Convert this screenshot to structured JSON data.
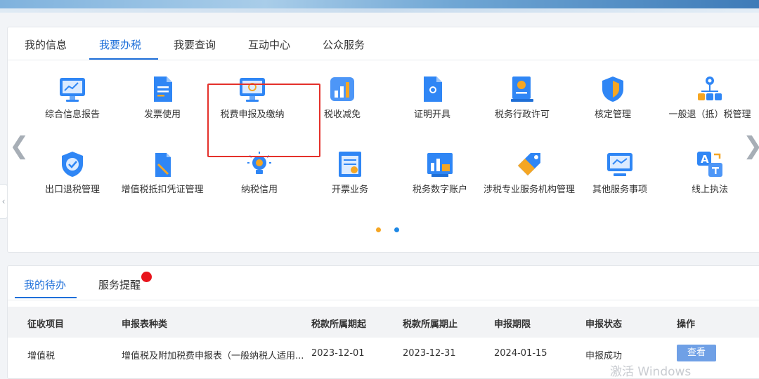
{
  "tabs": [
    "我的信息",
    "我要办税",
    "我要查询",
    "互动中心",
    "公众服务"
  ],
  "active_tab": "我要办税",
  "services": [
    {
      "label": "综合信息报告",
      "icon": "report-monitor-icon"
    },
    {
      "label": "发票使用",
      "icon": "invoice-document-icon"
    },
    {
      "label": "税费申报及缴纳",
      "icon": "tax-declare-monitor-icon"
    },
    {
      "label": "税收减免",
      "icon": "tax-reduction-chart-icon"
    },
    {
      "label": "证明开具",
      "icon": "certificate-document-icon"
    },
    {
      "label": "税务行政许可",
      "icon": "license-badge-icon"
    },
    {
      "label": "核定管理",
      "icon": "shield-icon"
    },
    {
      "label": "一般退（抵）税管理",
      "icon": "org-tree-icon"
    },
    {
      "label": "出口退税管理",
      "icon": "shield-check-icon"
    },
    {
      "label": "增值税抵扣凭证管理",
      "icon": "voucher-document-icon"
    },
    {
      "label": "纳税信用",
      "icon": "lightbulb-icon"
    },
    {
      "label": "开票业务",
      "icon": "invoice-window-icon"
    },
    {
      "label": "税务数字账户",
      "icon": "digital-account-chart-icon"
    },
    {
      "label": "涉税专业服务机构管理",
      "icon": "tag-icon"
    },
    {
      "label": "其他服务事项",
      "icon": "monitor-icon"
    },
    {
      "label": "线上执法",
      "icon": "translate-icon"
    }
  ],
  "carousel": {
    "prev_icon": "chevron-left-icon",
    "next_icon": "chevron-right-icon",
    "active_page": 1,
    "dot_colors": [
      "#f5a623",
      "#1e88e5"
    ]
  },
  "bottom_tabs": [
    "我的待办",
    "服务提醒"
  ],
  "table": {
    "headers": [
      "征收项目",
      "申报表种类",
      "税款所属期起",
      "税款所属期止",
      "申报期限",
      "申报状态",
      "操作"
    ],
    "rows": [
      {
        "item": "增值税",
        "form": "增值税及附加税费申报表（一般纳税人适用...",
        "period_start": "2023-12-01",
        "period_end": "2023-12-31",
        "deadline": "2024-01-15",
        "status": "申报成功",
        "action": "查看"
      }
    ]
  },
  "watermark": "激活 Windows",
  "colors": {
    "accent": "#1e6fd9",
    "highlight": "#e4312b",
    "badge": "#e8141c",
    "button": "#6fa0e6"
  }
}
